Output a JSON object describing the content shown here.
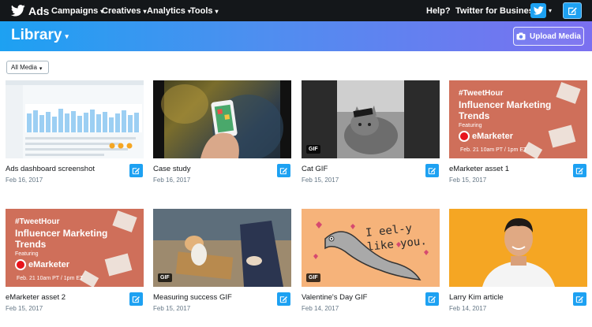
{
  "topbar": {
    "brand": "Ads",
    "nav": [
      {
        "label": "Campaigns"
      },
      {
        "label": "Creatives"
      },
      {
        "label": "Analytics"
      },
      {
        "label": "Tools"
      }
    ],
    "help": "Help?",
    "account": "Twitter for Business"
  },
  "library": {
    "title": "Library",
    "upload_label": "Upload Media"
  },
  "filter": {
    "selected": "All Media"
  },
  "media": [
    {
      "title": "Ads dashboard screenshot",
      "date": "Feb 16, 2017"
    },
    {
      "title": "Case study",
      "date": "Feb 16, 2017"
    },
    {
      "title": "Cat GIF",
      "date": "Feb 15, 2017",
      "badge": "GIF"
    },
    {
      "title": "eMarketer asset 1",
      "date": "Feb 15, 2017"
    },
    {
      "title": "eMarketer asset 2",
      "date": "Feb 15, 2017"
    },
    {
      "title": "Measuring success GIF",
      "date": "Feb 15, 2017",
      "badge": "GIF"
    },
    {
      "title": "Valentine's Day GIF",
      "date": "Feb 14, 2017",
      "badge": "GIF"
    },
    {
      "title": "Larry Kim article",
      "date": "Feb 14, 2017"
    }
  ],
  "promo": {
    "hashtag": "#TweetHour",
    "headline_line1": "Influencer Marketing",
    "headline_line2": "Trends",
    "featuring": "Featuring",
    "logo": "eMarketer",
    "event_time": "Feb. 21 10am PT / 1pm ET"
  },
  "eel_card": {
    "line1": "I eel-y",
    "line2": "like you."
  },
  "colors": {
    "topbar": "#14171a",
    "accent": "#1da1f2",
    "gradient_end": "#7b6ff0",
    "promo_bg": "#cf6f5a",
    "eel_bg": "#f6b37a",
    "larry_bg": "#f5a623"
  },
  "icons": {
    "brand": "twitter-bird-icon",
    "upload": "camera-icon",
    "edit": "compose-icon"
  }
}
